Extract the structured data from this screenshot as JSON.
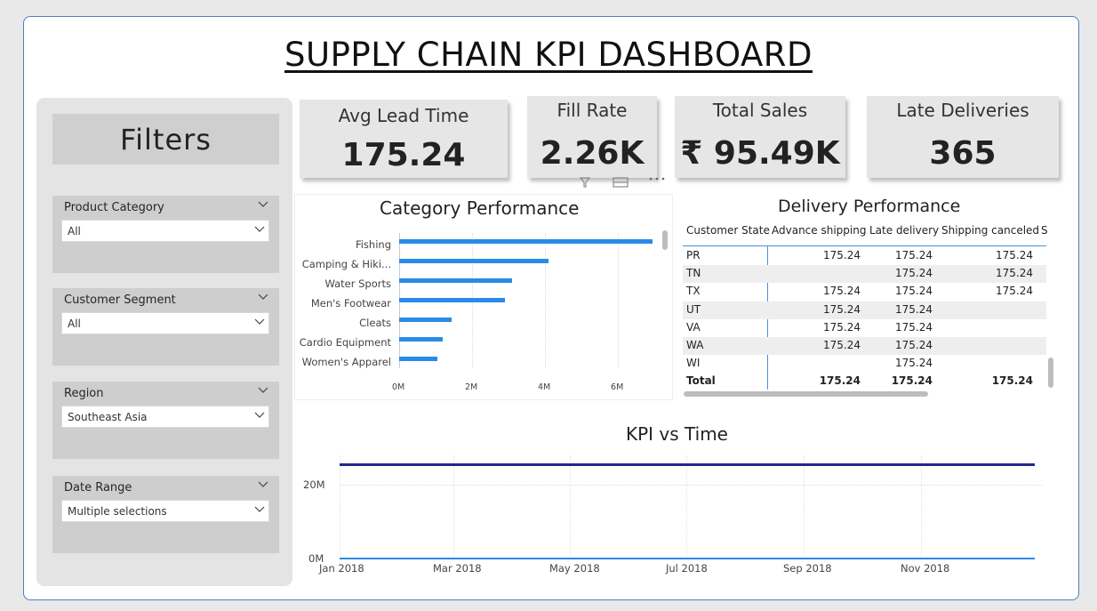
{
  "dashboard": {
    "title": "SUPPLY CHAIN KPI DASHBOARD"
  },
  "filters": {
    "header": "Filters",
    "slicers": [
      {
        "label": "Product Category",
        "value": "All"
      },
      {
        "label": "Customer Segment",
        "value": "All"
      },
      {
        "label": "Region",
        "value": "Southeast Asia"
      },
      {
        "label": "Date Range",
        "value": "Multiple selections"
      }
    ]
  },
  "kpis": [
    {
      "label": "Avg Lead Time",
      "value": "175.24"
    },
    {
      "label": "Fill Rate",
      "value": "2.26K"
    },
    {
      "label": "Total Sales",
      "value": "₹ 95.49K"
    },
    {
      "label": "Late Deliveries",
      "value": "365"
    }
  ],
  "category_chart": {
    "title": "Category Performance",
    "x_ticks": [
      "0M",
      "2M",
      "4M",
      "6M"
    ]
  },
  "delivery_table": {
    "title": "Delivery Performance",
    "columns": [
      "Customer State",
      "Advance shipping",
      "Late delivery",
      "Shipping canceled",
      "S"
    ],
    "rows": [
      {
        "state": "PR",
        "advance": "175.24",
        "late": "175.24",
        "canceled": "175.24"
      },
      {
        "state": "TN",
        "advance": "",
        "late": "175.24",
        "canceled": "175.24"
      },
      {
        "state": "TX",
        "advance": "175.24",
        "late": "175.24",
        "canceled": "175.24"
      },
      {
        "state": "UT",
        "advance": "175.24",
        "late": "175.24",
        "canceled": ""
      },
      {
        "state": "VA",
        "advance": "175.24",
        "late": "175.24",
        "canceled": ""
      },
      {
        "state": "WA",
        "advance": "175.24",
        "late": "175.24",
        "canceled": ""
      },
      {
        "state": "WI",
        "advance": "",
        "late": "175.24",
        "canceled": ""
      }
    ],
    "total": {
      "state": "Total",
      "advance": "175.24",
      "late": "175.24",
      "canceled": "175.24"
    }
  },
  "line_chart": {
    "title": "KPI vs Time",
    "y_ticks": [
      "20M",
      "0M"
    ],
    "x_ticks": [
      "Jan 2018",
      "Mar 2018",
      "May 2018",
      "Jul 2018",
      "Sep 2018",
      "Nov 2018"
    ]
  },
  "chart_data": [
    {
      "type": "bar",
      "orientation": "horizontal",
      "title": "Category Performance",
      "categories": [
        "Fishing",
        "Camping & Hiki...",
        "Water Sports",
        "Men's Footwear",
        "Cleats",
        "Cardio Equipment",
        "Women's Apparel"
      ],
      "values": [
        6.95,
        4.1,
        3.1,
        2.9,
        1.45,
        1.2,
        1.05
      ],
      "value_unit": "M",
      "xlim": [
        0,
        7.2
      ],
      "color": "#2a8ae6"
    },
    {
      "type": "line",
      "title": "KPI vs Time",
      "x": [
        "Jan 2018",
        "Dec 2018"
      ],
      "series": [
        {
          "values": [
            25.7,
            25.7
          ],
          "color": "#1f2a8c"
        },
        {
          "values": [
            0,
            0
          ],
          "color": "#2a8ae6"
        }
      ],
      "y_unit": "M",
      "ylim": [
        0,
        28
      ],
      "grid": true
    }
  ],
  "colors": {
    "accent": "#2a8ae6",
    "dark_series": "#1f2a8c",
    "frame": "#4a7fc1"
  },
  "icons": [
    "chevron-down-icon",
    "filter-icon",
    "focus-mode-icon",
    "more-options-icon"
  ]
}
